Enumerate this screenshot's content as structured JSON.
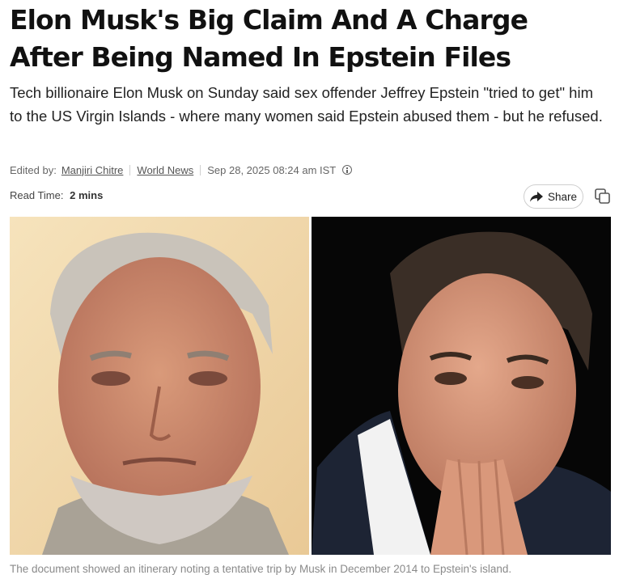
{
  "article": {
    "headline_line1": "Elon Musk's Big Claim And A Charge",
    "headline_line2": "After Being Named In Epstein Files",
    "summary": "Tech billionaire Elon Musk on Sunday said sex offender Jeffrey Epstein \"tried to get\" him to the US Virgin Islands - where many women said Epstein abused them - but he refused.",
    "meta": {
      "edited_by_label": "Edited by:",
      "editor": "Manjiri Chitre",
      "section": "World News",
      "date": "Sep 28, 2025 08:24 am IST"
    },
    "read_time_label": "Read Time:",
    "read_time_value": "2 mins",
    "share_label": "Share",
    "caption": "The document showed an itinerary noting a tentative trip by Musk in December 2014 to Epstein's island."
  },
  "icons": [
    "info-icon",
    "share-arrow-icon",
    "copy-icon"
  ],
  "colors": {
    "text": "#111111",
    "muted": "#666666",
    "caption": "#8a8a8a",
    "left_photo_bg": "#f2dcb0",
    "right_photo_bg": "#060606"
  }
}
